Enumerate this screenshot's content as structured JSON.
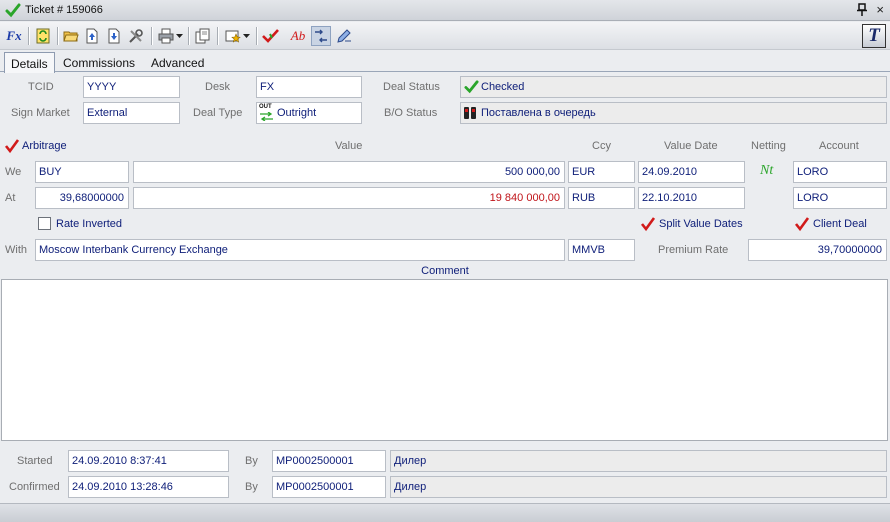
{
  "window": {
    "title": "Ticket # 159066",
    "close_glyph": "×"
  },
  "toolbar": {
    "fx_label": "Fx",
    "ab_label": "Ab",
    "logo_letter": "T"
  },
  "tabs": [
    {
      "label": "Details"
    },
    {
      "label": "Commissions"
    },
    {
      "label": "Advanced"
    }
  ],
  "header": {
    "tcid_label": "TCID",
    "tcid_value": "YYYY",
    "desk_label": "Desk",
    "desk_value": "FX",
    "deal_status_label": "Deal Status",
    "deal_status_value": "Checked",
    "sign_market_label": "Sign Market",
    "sign_market_value": "External",
    "deal_type_label": "Deal Type",
    "deal_type_icon_text": "OUT",
    "deal_type_value": "Outright",
    "bo_status_label": "B/O Status",
    "bo_status_value": "Поставлена в очередь"
  },
  "grid": {
    "arbitrage_label": "Arbitrage",
    "value_header": "Value",
    "ccy_header": "Ccy",
    "value_date_header": "Value Date",
    "netting_header": "Netting",
    "account_header": "Account",
    "we_label": "We",
    "we_side": "BUY",
    "we_value": "500 000,00",
    "we_ccy": "EUR",
    "we_value_date": "24.09.2010",
    "netting_value": "Nt",
    "we_account": "LORO",
    "at_label": "At",
    "at_rate": "39,68000000",
    "at_value": "19 840 000,00",
    "at_ccy": "RUB",
    "at_value_date": "22.10.2010",
    "at_account": "LORO",
    "rate_inverted_label": "Rate Inverted",
    "split_value_dates_label": "Split Value Dates",
    "client_deal_label": "Client Deal",
    "with_label": "With",
    "with_value": "Moscow Interbank Currency Exchange",
    "with_code": "MMVB",
    "premium_rate_label": "Premium Rate",
    "premium_rate_value": "39,70000000"
  },
  "comment": {
    "label": "Comment",
    "value": ""
  },
  "footer": {
    "started_label": "Started",
    "started_value": "24.09.2010 8:37:41",
    "started_by_label": "By",
    "started_by_id": "MP0002500001",
    "started_by_role": "Дилер",
    "confirmed_label": "Confirmed",
    "confirmed_value": "24.09.2010 13:28:46",
    "confirmed_by_label": "By",
    "confirmed_by_id": "MP0002500001",
    "confirmed_by_role": "Дилер"
  },
  "colors": {
    "accent_blue": "#10207a",
    "negative_red": "#c0141a",
    "check_green": "#2aa52a",
    "check_red": "#d11a1a"
  }
}
